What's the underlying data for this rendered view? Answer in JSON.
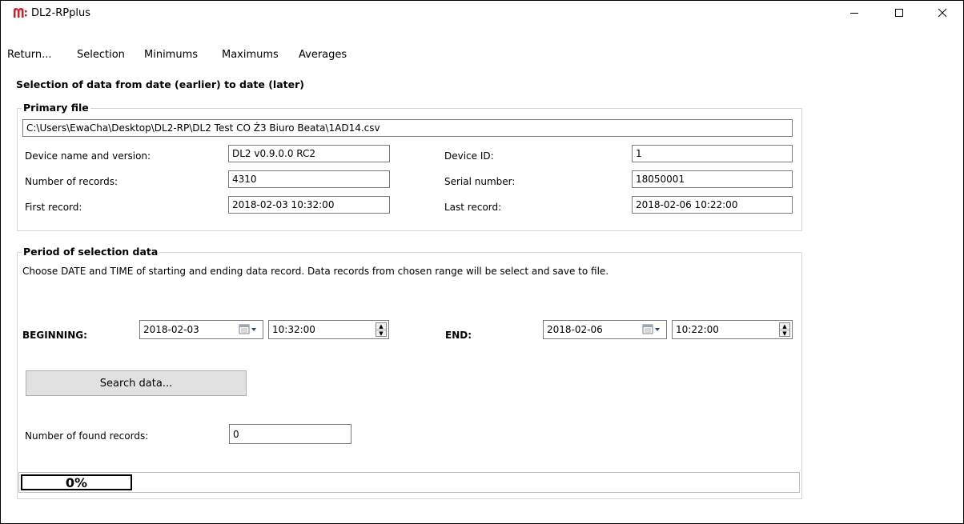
{
  "window": {
    "title": "DL2-RPplus",
    "brand_color": "#d21f26"
  },
  "menu": {
    "items": [
      "Return...",
      "Selection",
      "Minimums",
      "Maximums",
      "Averages"
    ]
  },
  "page": {
    "heading": "Selection of data from date (earlier) to date (later)"
  },
  "primary_file": {
    "title": "Primary file",
    "path": "C:\\Users\\EwaCha\\Desktop\\DL2-RP\\DL2 Test CO Ż3 Biuro Beata\\1AD14.csv",
    "device_name_label": "Device name and version:",
    "device_name_value": "DL2 v0.9.0.0 RC2",
    "device_id_label": "Device ID:",
    "device_id_value": "1",
    "num_records_label": "Number of records:",
    "num_records_value": "4310",
    "serial_label": "Serial number:",
    "serial_value": "18050001",
    "first_record_label": "First record:",
    "first_record_value": "2018-02-03 10:32:00",
    "last_record_label": "Last record:",
    "last_record_value": "2018-02-06 10:22:00"
  },
  "period": {
    "title": "Period of selection data",
    "description": "Choose  DATE and TIME of starting and ending data record. Data records from chosen range will be select and save to file.",
    "beginning_label": "BEGINNING:",
    "beginning_date": "2018-02-03",
    "beginning_time": "10:32:00",
    "end_label": "END:",
    "end_date": "2018-02-06",
    "end_time": "10:22:00",
    "search_button": "Search data...",
    "found_label": "Number of found records:",
    "found_value": "0",
    "progress_text": "0%",
    "progress_fraction": 0
  }
}
